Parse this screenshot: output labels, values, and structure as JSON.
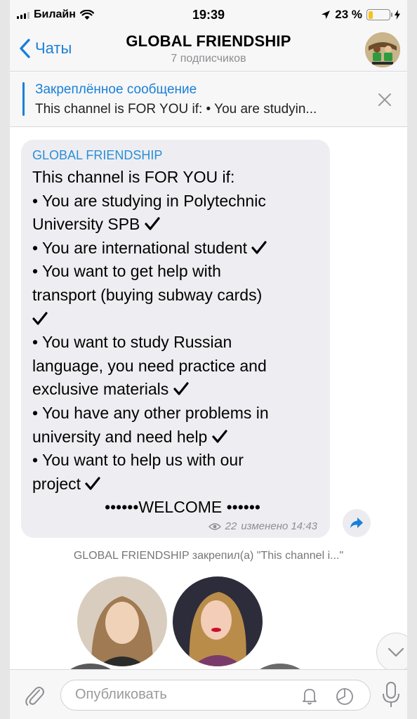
{
  "status_bar": {
    "carrier": "Билайн",
    "time": "19:39",
    "battery_percent": "23 %",
    "battery_level": 0.23
  },
  "nav": {
    "back_label": "Чаты",
    "title": "GLOBAL FRIENDSHIP",
    "subtitle": "7 подписчиков"
  },
  "pinned": {
    "label": "Закреплённое сообщение",
    "text": "This channel is FOR YOU if: • You are studyin..."
  },
  "message": {
    "author": "GLOBAL FRIENDSHIP",
    "lines": [
      "This channel is FOR YOU if:",
      "• You are studying in Polytechnic",
      "University SPB",
      "• You are international student",
      "• You want to get help with",
      "transport (buying subway cards)",
      "",
      "•  You want to study Russian",
      "language, you need practice and",
      "exclusive materials",
      "• You have any other problems in",
      "university and need help",
      "• You want to help us with our",
      "project",
      "••••••WELCOME ••••••"
    ],
    "views": "22",
    "edited": "изменено 14:43"
  },
  "service_message": "GLOBAL FRIENDSHIP закрепил(а) \"This channel i...\"",
  "input": {
    "placeholder": "Опубликовать"
  },
  "colors": {
    "accent": "#1a7fd8",
    "bubble": "#eeeef2",
    "author": "#2a8fd6"
  }
}
